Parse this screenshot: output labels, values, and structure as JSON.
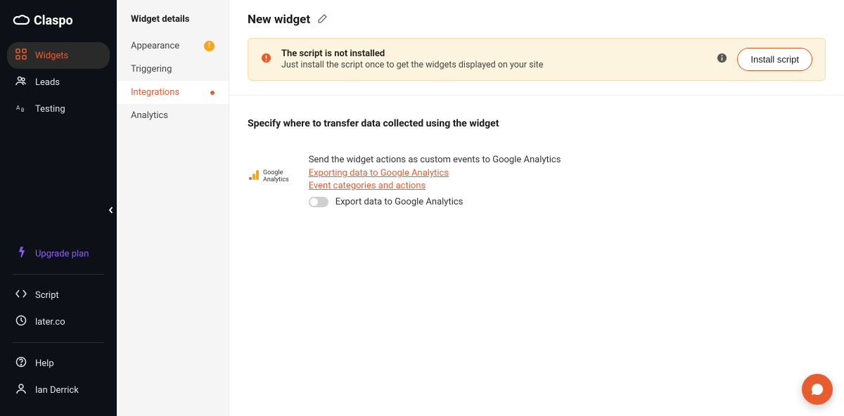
{
  "brand": "Claspo",
  "main_nav": {
    "widgets": "Widgets",
    "leads": "Leads",
    "testing": "Testing",
    "upgrade": "Upgrade plan",
    "script": "Script",
    "domain": "later.co",
    "help": "Help",
    "user": "Ian Derrick"
  },
  "sec_sidebar": {
    "title": "Widget details",
    "items": {
      "appearance": "Appearance",
      "triggering": "Triggering",
      "integrations": "Integrations",
      "analytics": "Analytics"
    }
  },
  "page": {
    "title": "New widget"
  },
  "banner": {
    "title": "The script is not installed",
    "desc": "Just install the script once to get the widgets displayed on your site",
    "button": "Install script"
  },
  "integrations": {
    "section_title": "Specify where to transfer data collected using the widget",
    "ga": {
      "brand_line1": "Google",
      "brand_line2": "Analytics",
      "desc": "Send the widget actions as custom events to Google Analytics",
      "link1": "Exporting data to Google Analytics",
      "link2": "Event categories and actions",
      "toggle_label": "Export data to Google Analytics"
    }
  }
}
